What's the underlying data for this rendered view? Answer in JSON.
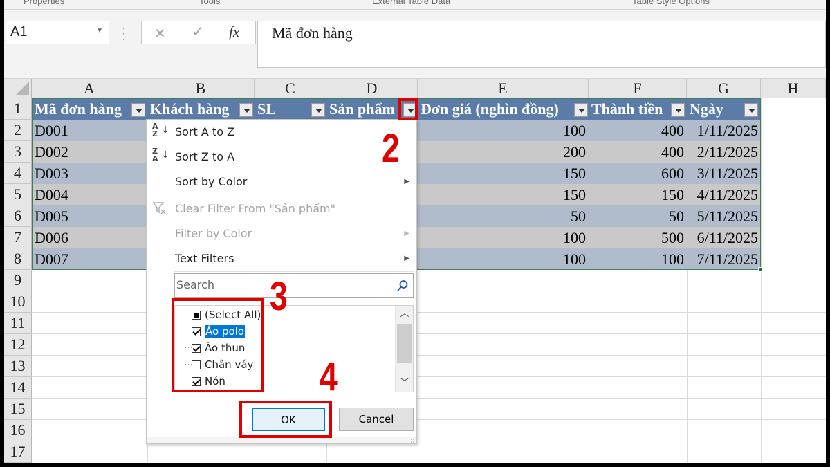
{
  "ribbon": {
    "groups": [
      "Properties",
      "Tools",
      "External Table Data",
      "Table Style Options"
    ]
  },
  "formula_bar": {
    "name_box": "A1",
    "cancel_icon": "✕",
    "enter_icon": "✓",
    "fx_label": "fx",
    "value": "Mã đơn hàng"
  },
  "columns": [
    "A",
    "B",
    "C",
    "D",
    "E",
    "F",
    "G",
    "H"
  ],
  "rows": [
    "1",
    "2",
    "3",
    "4",
    "5",
    "6",
    "7",
    "8",
    "9",
    "10",
    "11",
    "12",
    "13",
    "14",
    "15",
    "16",
    "17"
  ],
  "table": {
    "headers": [
      "Mã đơn hàng",
      "Khách hàng",
      "SL",
      "Sản phẩm",
      "Đơn giá (nghìn đồng)",
      "Thành tiền",
      "Ngày"
    ],
    "rows": [
      {
        "id": "D001",
        "price": "100",
        "total": "400",
        "date": "1/11/2025"
      },
      {
        "id": "D002",
        "price": "200",
        "total": "400",
        "date": "2/11/2025"
      },
      {
        "id": "D003",
        "price": "150",
        "total": "600",
        "date": "3/11/2025"
      },
      {
        "id": "D004",
        "price": "150",
        "total": "150",
        "date": "4/11/2025"
      },
      {
        "id": "D005",
        "price": "50",
        "total": "50",
        "date": "5/11/2025"
      },
      {
        "id": "D006",
        "price": "100",
        "total": "500",
        "date": "6/11/2025"
      },
      {
        "id": "D007",
        "price": "100",
        "total": "100",
        "date": "7/11/2025"
      }
    ]
  },
  "filter_menu": {
    "sort_az": "Sort A to Z",
    "sort_za": "Sort Z to A",
    "sort_color": "Sort by Color",
    "clear_filter": "Clear Filter From \"Sản phẩm\"",
    "filter_color": "Filter by Color",
    "text_filters": "Text Filters",
    "search_placeholder": "Search",
    "items": [
      {
        "label": "(Select All)",
        "state": "partial"
      },
      {
        "label": "Áo polo",
        "state": "checked"
      },
      {
        "label": "Áo thun",
        "state": "checked"
      },
      {
        "label": "Chân váy",
        "state": "unchecked"
      },
      {
        "label": "Nón",
        "state": "checked"
      }
    ],
    "ok": "OK",
    "cancel": "Cancel"
  },
  "annotations": [
    "2",
    "3",
    "4"
  ],
  "colors": {
    "table_header": "#5b7ca8",
    "band_odd": "#b0bccb",
    "band_even": "#c9c9c9",
    "annotation": "#e00000",
    "selection": "#0078d7"
  }
}
